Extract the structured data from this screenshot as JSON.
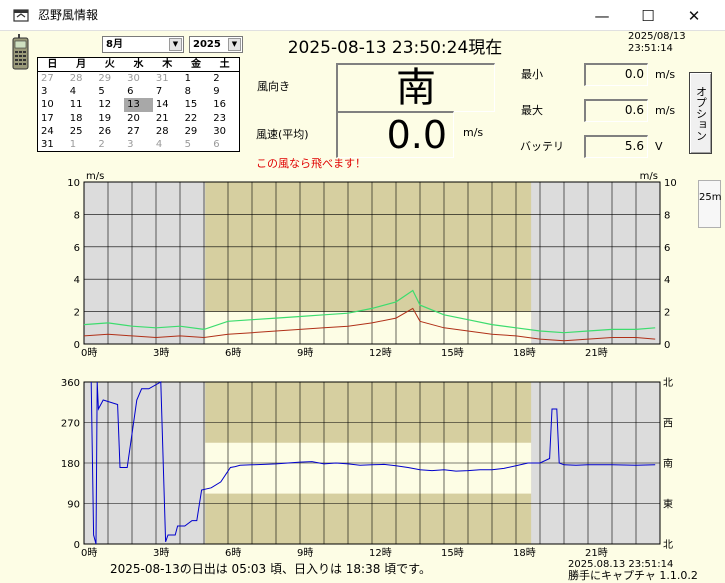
{
  "window": {
    "title": "忍野風情報",
    "minimize": "—",
    "maximize": "☐",
    "close": "✕"
  },
  "calendar": {
    "month_value": "8月",
    "year_value": "2025",
    "weekdays": [
      "日",
      "月",
      "火",
      "水",
      "木",
      "金",
      "土"
    ],
    "days": [
      [
        "27",
        "28",
        "29",
        "30",
        "31",
        "1",
        "2"
      ],
      [
        "3",
        "4",
        "5",
        "6",
        "7",
        "8",
        "9"
      ],
      [
        "10",
        "11",
        "12",
        "13",
        "14",
        "15",
        "16"
      ],
      [
        "17",
        "18",
        "19",
        "20",
        "21",
        "22",
        "23"
      ],
      [
        "24",
        "25",
        "26",
        "27",
        "28",
        "29",
        "30"
      ],
      [
        "31",
        "1",
        "2",
        "3",
        "4",
        "5",
        "6"
      ]
    ],
    "selected_day": "13"
  },
  "header": {
    "datetime": "2025-08-13 23:50:24現在",
    "capture_date": "2025/08/13",
    "capture_time": "23:51:14"
  },
  "wind": {
    "direction_label": "風向き",
    "direction_value": "南",
    "speed_label": "風速(平均)",
    "speed_value": "0.0",
    "speed_unit": "m/s",
    "fly_message": "この風なら飛べます！"
  },
  "stats": {
    "min_label": "最小",
    "min_value": "0.0",
    "min_unit": "m/s",
    "max_label": "最大",
    "max_value": "0.6",
    "max_unit": "m/s",
    "battery_label": "バッテリ",
    "battery_value": "5.6",
    "battery_unit": "V"
  },
  "buttons": {
    "option": "オプション",
    "range": "25m"
  },
  "colors": {
    "background": "#fdfde5",
    "night": "#dcdcdc",
    "day": "#d6cfa0",
    "band": "#fdfde5",
    "gust": "#3ddc6e",
    "avg": "#b03018",
    "direction": "#0000cc"
  },
  "chart_data": [
    {
      "type": "line",
      "title": "",
      "xlabel": "",
      "ylabel": "m/s",
      "y_unit_left": "m/s",
      "y_unit_right": "m/s",
      "xlim": [
        0,
        24
      ],
      "ylim": [
        0,
        10
      ],
      "x_ticks": [
        "0時",
        "3時",
        "6時",
        "9時",
        "12時",
        "15時",
        "18時",
        "21時"
      ],
      "x_tick_values": [
        0,
        3,
        6,
        9,
        12,
        15,
        18,
        21
      ],
      "y_ticks": [
        "0",
        "2",
        "4",
        "6",
        "8",
        "10"
      ],
      "y_tick_values": [
        0,
        2,
        4,
        6,
        8,
        10
      ],
      "grid": true,
      "daytime_shading_hours": [
        5.05,
        18.63
      ],
      "series": [
        {
          "kind": "gust_range",
          "x": [
            0,
            1,
            2,
            3,
            4,
            5,
            6,
            7,
            8,
            9,
            10,
            11,
            12,
            13,
            13.7,
            14,
            15,
            16,
            17,
            18,
            19,
            20,
            21,
            22,
            23,
            23.8
          ],
          "values": [
            1.2,
            1.3,
            1.1,
            1.0,
            1.1,
            0.9,
            1.4,
            1.5,
            1.6,
            1.7,
            1.8,
            1.9,
            2.2,
            2.6,
            3.3,
            2.4,
            1.8,
            1.5,
            1.2,
            1.0,
            0.8,
            0.7,
            0.8,
            0.9,
            0.9,
            1.0
          ]
        },
        {
          "kind": "average",
          "x": [
            0,
            1,
            2,
            3,
            4,
            5,
            6,
            7,
            8,
            9,
            10,
            11,
            12,
            13,
            13.7,
            14,
            15,
            16,
            17,
            18,
            19,
            20,
            21,
            22,
            23,
            23.8
          ],
          "values": [
            0.5,
            0.6,
            0.5,
            0.4,
            0.5,
            0.4,
            0.6,
            0.7,
            0.8,
            0.9,
            1.0,
            1.1,
            1.3,
            1.6,
            2.2,
            1.4,
            1.0,
            0.8,
            0.6,
            0.5,
            0.3,
            0.2,
            0.3,
            0.4,
            0.4,
            0.3
          ]
        }
      ]
    },
    {
      "type": "line",
      "title": "",
      "xlabel": "",
      "ylabel": "",
      "xlim": [
        0,
        24
      ],
      "ylim": [
        0,
        360
      ],
      "x_ticks": [
        "0時",
        "3時",
        "6時",
        "9時",
        "12時",
        "15時",
        "18時",
        "21時"
      ],
      "x_tick_values": [
        0,
        3,
        6,
        9,
        12,
        15,
        18,
        21
      ],
      "y_ticks": [
        "0",
        "90",
        "180",
        "270",
        "360"
      ],
      "y_tick_values": [
        0,
        90,
        180,
        270,
        360
      ],
      "y_ticks_right": [
        "北",
        "東",
        "南",
        "西",
        "北"
      ],
      "grid": true,
      "daytime_shading_hours": [
        5.05,
        18.63
      ],
      "band_degrees": [
        112,
        225
      ],
      "series": [
        {
          "kind": "direction",
          "x": [
            0.3,
            0.4,
            0.5,
            0.55,
            0.6,
            0.8,
            1.4,
            1.5,
            1.7,
            1.8,
            2.2,
            2.4,
            2.7,
            3.2,
            3.4,
            3.5,
            3.8,
            3.9,
            4.2,
            4.5,
            4.7,
            4.9,
            5.3,
            5.7,
            6.1,
            6.3,
            6.5,
            7,
            7.5,
            8,
            8.5,
            9,
            9.5,
            10,
            10.5,
            11,
            11.5,
            12,
            12.5,
            13,
            13.5,
            14,
            14.5,
            15,
            15.5,
            16,
            16.5,
            17,
            17.5,
            18,
            18.5,
            19,
            19.4,
            19.5,
            19.7,
            19.8,
            20,
            20.5,
            21,
            22,
            23,
            23.8
          ],
          "values": [
            360,
            20,
            0,
            360,
            300,
            320,
            310,
            170,
            170,
            170,
            320,
            345,
            345,
            360,
            5,
            20,
            20,
            40,
            40,
            52,
            52,
            120,
            125,
            138,
            170,
            172,
            175,
            176,
            177,
            178,
            180,
            182,
            183,
            178,
            180,
            178,
            175,
            176,
            177,
            174,
            170,
            165,
            163,
            165,
            162,
            163,
            165,
            165,
            168,
            174,
            180,
            180,
            190,
            300,
            300,
            180,
            176,
            175,
            176,
            176,
            175,
            176
          ]
        }
      ]
    }
  ],
  "footer": {
    "sun_info": "2025-08-13の日出は 05:03 頃、日入りは 18:38 頃です。",
    "capture_stamp": "2025.08.13 23:51:14",
    "capture_version": "勝手にキャプチャ 1.1.0.2"
  }
}
